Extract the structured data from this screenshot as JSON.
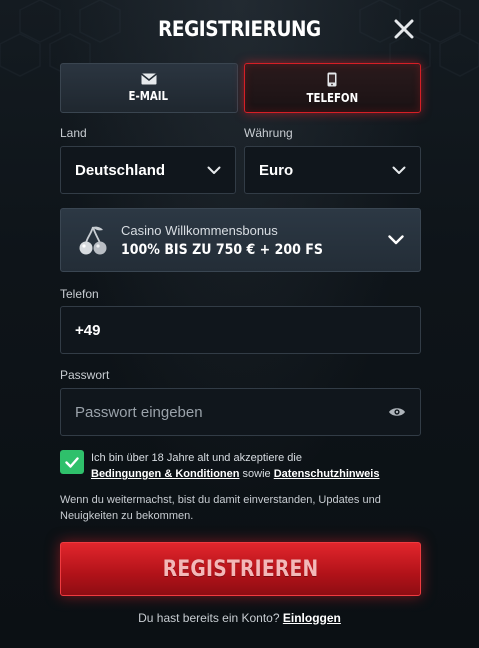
{
  "header": {
    "title": "REGISTRIERUNG"
  },
  "tabs": [
    {
      "label": "E-MAIL",
      "icon": "envelope-icon",
      "active": false
    },
    {
      "label": "TELEFON",
      "icon": "phone-icon",
      "active": true
    }
  ],
  "form": {
    "country": {
      "label": "Land",
      "value": "Deutschland"
    },
    "currency": {
      "label": "Währung",
      "value": "Euro"
    },
    "bonus": {
      "icon": "cherries-icon",
      "subtitle": "Casino Willkommensbonus",
      "title": "100% BIS ZU 750 € + 200 FS"
    },
    "phone": {
      "label": "Telefon",
      "value": "+49"
    },
    "password": {
      "label": "Passwort",
      "placeholder": "Passwort eingeben",
      "icon": "eye-icon"
    },
    "consent": {
      "checked": true,
      "text": "Ich bin über 18 Jahre alt und akzeptiere die",
      "terms_link": "Bedingungen & Konditionen",
      "joiner": "sowie",
      "privacy_link": "Datenschutzhinweis"
    },
    "notice": "Wenn du weitermachst, bist du damit einverstanden, Updates und Neuigkeiten zu bekommen.",
    "submit_label": "REGISTRIEREN"
  },
  "footer": {
    "question": "Du hast bereits ein Konto?",
    "login_link": "Einloggen"
  },
  "colors": {
    "accent_red": "#d61f26",
    "check_green": "#2fc06b",
    "background": "#0d1318"
  }
}
